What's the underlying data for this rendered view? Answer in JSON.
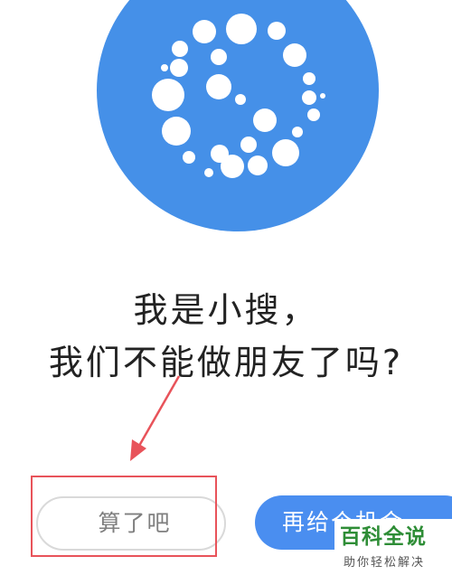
{
  "logo": {
    "icon": "dotted-circle-logo-icon",
    "color": "#4590e8"
  },
  "dialog": {
    "line1": "我是小搜，",
    "line2": "我们不能做朋友了吗?"
  },
  "buttons": {
    "cancel_label": "算了吧",
    "retry_label": "再给个机会"
  },
  "annotation": {
    "color": "#e8535a",
    "icon": "red-arrow-icon"
  },
  "watermark": {
    "title": "百科全说",
    "subtitle": "助你轻松解决",
    "color": "#2e8d36"
  }
}
